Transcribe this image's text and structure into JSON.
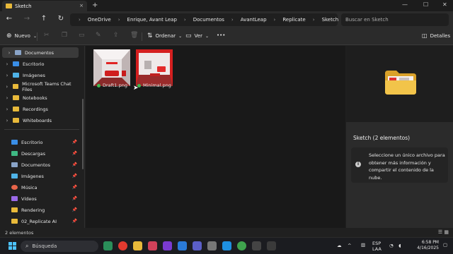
{
  "window": {
    "tab_title": "Sketch",
    "tab_close_icon": "×",
    "new_tab_icon": "+",
    "controls": {
      "minimize": "—",
      "maximize": "☐",
      "close": "✕"
    }
  },
  "nav": {
    "back": "←",
    "forward": "→",
    "up": "↑",
    "refresh": "↻"
  },
  "address": {
    "breadcrumb": [
      "OneDrive",
      "Enrique, Avant Leap",
      "Documentos",
      "AvantLeap",
      "Replicate",
      "Sketch"
    ],
    "separator": "›",
    "search_placeholder": "Buscar en Sketch"
  },
  "toolbar": {
    "new_label": "Nuevo",
    "sort_label": "Ordenar",
    "view_label": "Ver",
    "more_label": "•••",
    "details_label": "Detalles"
  },
  "sidebar": {
    "tree_items": [
      {
        "label": "Documentos",
        "icon": "documents-icon",
        "color": "#8aa4c8",
        "selected": true
      },
      {
        "label": "Escritorio",
        "icon": "desktop-icon",
        "color": "#3a8ee6",
        "selected": false
      },
      {
        "label": "Imágenes",
        "icon": "pictures-icon",
        "color": "#4fb3e8",
        "selected": false
      },
      {
        "label": "Microsoft Teams Chat Files",
        "icon": "folder-icon",
        "color": "#e8b93a",
        "selected": false
      },
      {
        "label": "Notebooks",
        "icon": "folder-icon",
        "color": "#e8b93a",
        "selected": false
      },
      {
        "label": "Recordings",
        "icon": "folder-icon",
        "color": "#e8b93a",
        "selected": false
      },
      {
        "label": "Whiteboards",
        "icon": "folder-icon",
        "color": "#e8b93a",
        "selected": false
      }
    ],
    "quick_access": [
      {
        "label": "Escritorio",
        "icon": "desktop-icon",
        "color": "#3a8ee6"
      },
      {
        "label": "Descargas",
        "icon": "downloads-icon",
        "color": "#3fb984"
      },
      {
        "label": "Documentos",
        "icon": "documents-icon",
        "color": "#8aa4c8"
      },
      {
        "label": "Imágenes",
        "icon": "pictures-icon",
        "color": "#4fb3e8"
      },
      {
        "label": "Música",
        "icon": "music-icon",
        "color": "#e8654a"
      },
      {
        "label": "Vídeos",
        "icon": "videos-icon",
        "color": "#9b6ae8"
      },
      {
        "label": "Rendering",
        "icon": "folder-icon",
        "color": "#e8b93a"
      },
      {
        "label": "02_Replicate AI",
        "icon": "folder-icon",
        "color": "#e8b93a"
      }
    ]
  },
  "files": [
    {
      "name": "Draft1.png",
      "status_color": "#3fb950"
    },
    {
      "name": "Minimal.png",
      "status_color": "#3fb950"
    }
  ],
  "details": {
    "title": "Sketch (2 elementos)",
    "message": "Seleccione un único archivo para obtener más información y compartir el contenido de la nube."
  },
  "status": {
    "count": "2 elementos"
  },
  "taskbar": {
    "search_label": "Búsqueda",
    "language": "ESP",
    "region": "LAA",
    "time": "6:58 PM",
    "date": "4/16/2025"
  },
  "colors": {
    "accent": "#4cc2ff",
    "folder": "#e8b93a",
    "sync_ok": "#3fb950"
  }
}
